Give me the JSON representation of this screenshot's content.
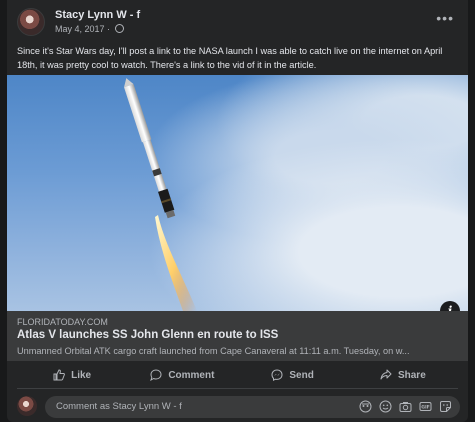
{
  "post": {
    "author": "Stacy Lynn W - f",
    "date": "May 4, 2017",
    "separator": "·",
    "more_label": "•••",
    "text": "Since it's Star Wars day, I'll post a link to the NASA launch I was able to catch live on the internet on April 18th, it was pretty cool to watch.  There's a link to the vid of it in the article."
  },
  "link_preview": {
    "domain": "FLORIDATODAY.COM",
    "title": "Atlas V launches SS John Glenn en route to ISS",
    "description": "Unmanned Orbital ATK cargo craft launched from Cape Canaveral at 11:11 a.m. Tuesday, on w...",
    "info_label": "i"
  },
  "actions": {
    "like": "Like",
    "comment": "Comment",
    "send": "Send",
    "share": "Share"
  },
  "comment_box": {
    "placeholder": "Comment as Stacy Lynn W - f"
  },
  "colors": {
    "background": "#18191a",
    "card": "#242526",
    "link_box": "#3a3b3c",
    "primary_text": "#e4e6eb",
    "secondary_text": "#b0b3b8"
  }
}
